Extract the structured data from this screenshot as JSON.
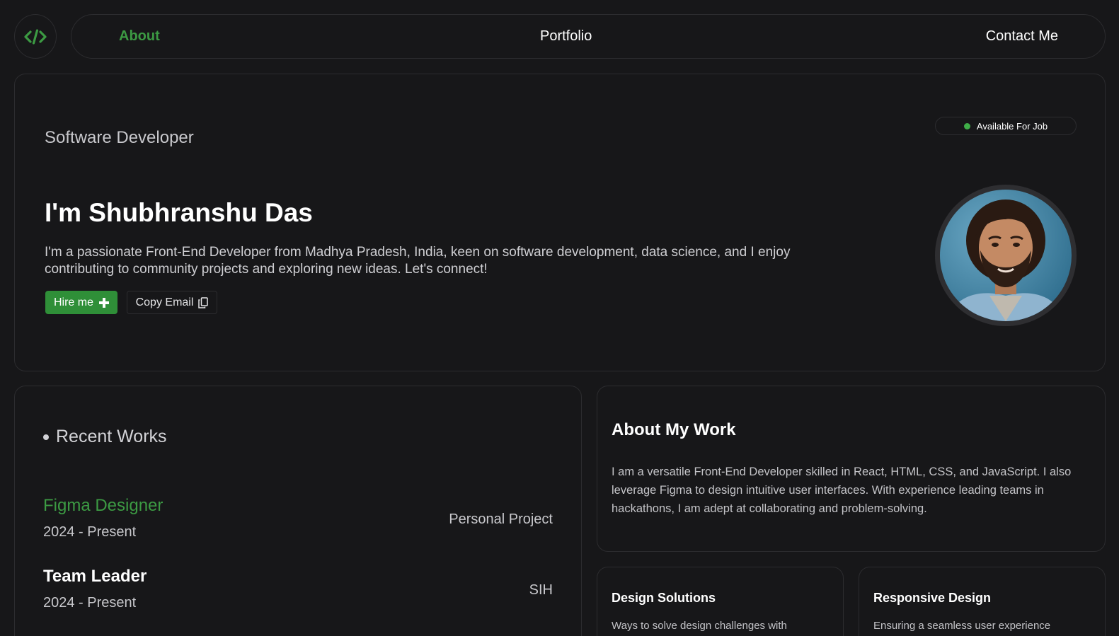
{
  "nav": {
    "logo_icon": "code-icon",
    "items": [
      {
        "label": "About",
        "active": true
      },
      {
        "label": "Portfolio",
        "active": false
      },
      {
        "label": "Contact Me",
        "active": false
      }
    ]
  },
  "hero": {
    "role": "Software Developer",
    "availability": "Available For Job",
    "name": "I'm Shubhranshu Das",
    "bio": "I'm a passionate Front-End Developer from Madhya Pradesh, India, keen on software development, data science, and I enjoy contributing to community projects and exploring new ideas. Let's connect!",
    "hire_label": "Hire me",
    "copy_label": "Copy Email"
  },
  "works": {
    "title": "Recent Works",
    "items": [
      {
        "role": "Figma Designer",
        "date": "2024 - Present",
        "tag": "Personal Project"
      },
      {
        "role": "Team Leader",
        "date": "2024 - Present",
        "tag": "SIH"
      }
    ]
  },
  "about": {
    "title": "About My Work",
    "text": "I am a versatile Front-End Developer skilled in React, HTML, CSS, and JavaScript. I also leverage Figma to design intuitive user interfaces. With experience leading teams in hackathons, I am adept at collaborating and problem-solving."
  },
  "features": [
    {
      "title": "Design Solutions",
      "text": "Ways to solve design challenges with"
    },
    {
      "title": "Responsive Design",
      "text": "Ensuring a seamless user experience"
    }
  ],
  "colors": {
    "background": "#171719",
    "accent": "#3c9a43",
    "border": "#2c2c2f",
    "status_dot": "#3fae48"
  }
}
